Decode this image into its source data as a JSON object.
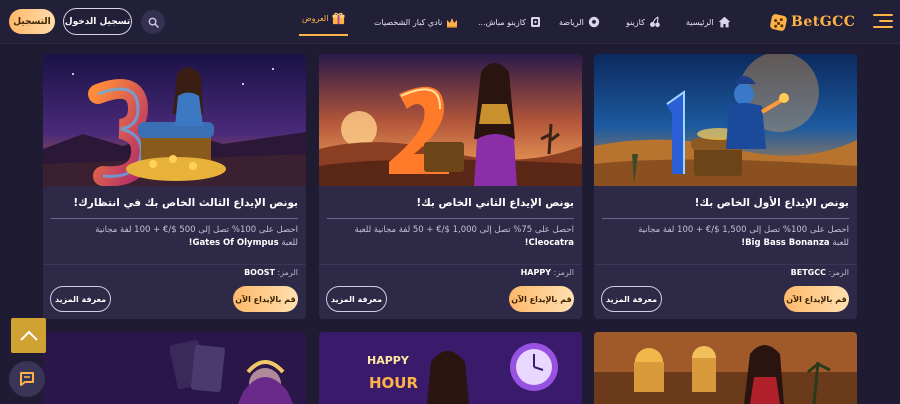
{
  "header": {
    "register_label": "التسجيل",
    "login_label": "تسجيل الدخول",
    "nav": [
      {
        "label": "العروض",
        "icon": "gift-icon",
        "active": true
      },
      {
        "label": "نادي كبار الشخصيات",
        "icon": "crown-icon",
        "active": false
      },
      {
        "label": "كازينو مباش...",
        "icon": "live-casino-icon",
        "active": false
      },
      {
        "label": "الرياضة",
        "icon": "soccer-ball-icon",
        "active": false
      },
      {
        "label": "كازينو",
        "icon": "cherries-icon",
        "active": false
      },
      {
        "label": "الرئيسية",
        "icon": "home-icon",
        "active": false
      }
    ],
    "logo_text": "BetGCC",
    "accent_color": "#ffb347"
  },
  "cards": [
    {
      "title": "بونص الإيداع الثالث الخاص بك في انتظارك!",
      "desc_line1": "احصل على 100% تصل إلى 500 $/€ + 100 لفة مجانية",
      "desc_line2_prefix": "للعبة",
      "desc_game": "Gates Of Olympus!",
      "code_label": "الرمز:",
      "code": "BOOST",
      "deposit_label": "قم بالإيداع الآن",
      "more_label": "معرفة المزيد"
    },
    {
      "title": "بونص الإيداع الثاني الخاص بك!",
      "desc_line1": "احصل على 75% تصل إلى 1,000 $/€ + 50 لفة مجانية للعبة",
      "desc_line2_prefix": "",
      "desc_game": "Cleocatra!",
      "code_label": "الرمز:",
      "code": "HAPPY",
      "deposit_label": "قم بالإيداع الآن",
      "more_label": "معرفة المزيد"
    },
    {
      "title": "بونص الإيداع الأول الخاص بك!",
      "desc_line1": "احصل على 100% تصل إلى 1,500 $/€ + 100 لفة مجانية",
      "desc_line2_prefix": "للعبة",
      "desc_game": "Big Bass Bonanza!",
      "code_label": "الرمز:",
      "code": "BETGCC",
      "deposit_label": "قم بالإيداع الآن",
      "more_label": "معرفة المزيد"
    }
  ],
  "promo_art": {
    "card2_neon_line1": "HAPPY",
    "card2_neon_line2": "HOUR"
  }
}
